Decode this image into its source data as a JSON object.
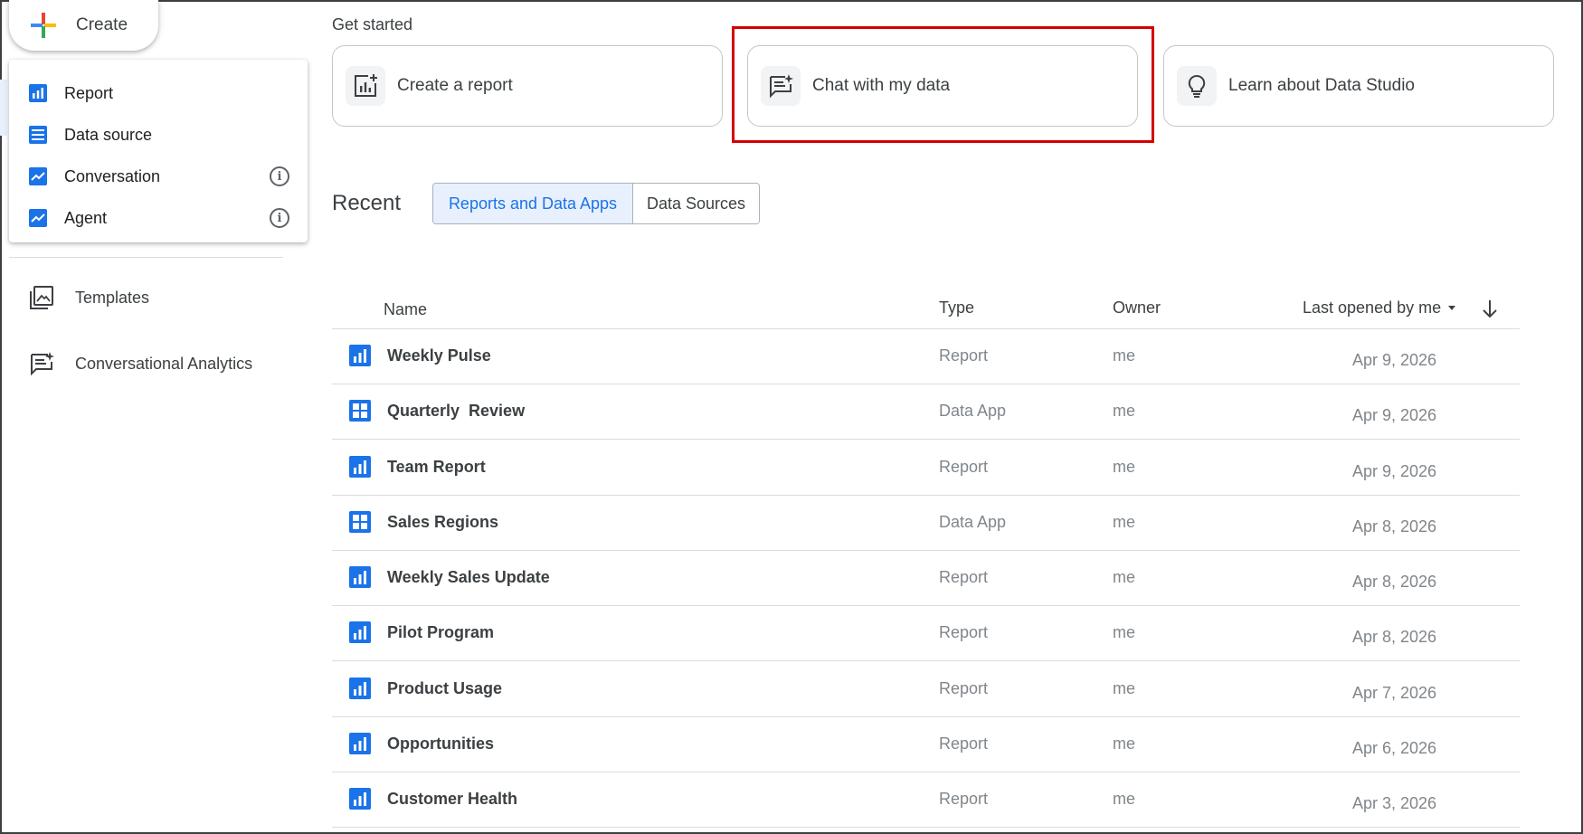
{
  "create": {
    "label": "Create"
  },
  "create_menu": {
    "items": [
      {
        "label": "Report",
        "icon": "report-icon"
      },
      {
        "label": "Data source",
        "icon": "data-source-icon"
      },
      {
        "label": "Conversation",
        "icon": "conversation-icon",
        "info": true
      },
      {
        "label": "Agent",
        "icon": "agent-icon",
        "info": true
      }
    ]
  },
  "sidebar": {
    "items": [
      {
        "label": "Templates",
        "icon": "templates-icon"
      },
      {
        "label": "Conversational Analytics",
        "icon": "conversational-analytics-icon"
      }
    ]
  },
  "get_started": {
    "title": "Get started",
    "cards": [
      {
        "label": "Create a report",
        "icon": "create-report-icon"
      },
      {
        "label": "Chat with my data",
        "icon": "chat-data-icon"
      },
      {
        "label": "Learn about Data Studio",
        "icon": "lightbulb-icon"
      }
    ]
  },
  "recent": {
    "title": "Recent",
    "tabs": [
      {
        "label": "Reports and Data Apps",
        "active": true
      },
      {
        "label": "Data Sources",
        "active": false
      }
    ],
    "columns": {
      "name": "Name",
      "type": "Type",
      "owner": "Owner",
      "last_opened": "Last opened by me"
    },
    "rows": [
      {
        "name": "Weekly Pulse",
        "type": "Report",
        "owner": "me",
        "date": "Apr 9, 2026",
        "icon": "report-icon"
      },
      {
        "name": "Quarterly  Review",
        "type": "Data App",
        "owner": "me",
        "date": "Apr 9, 2026",
        "icon": "data-app-icon"
      },
      {
        "name": "Team Report",
        "type": "Report",
        "owner": "me",
        "date": "Apr 9, 2026",
        "icon": "report-icon"
      },
      {
        "name": "Sales Regions",
        "type": "Data App",
        "owner": "me",
        "date": "Apr 8, 2026",
        "icon": "data-app-icon"
      },
      {
        "name": "Weekly Sales Update",
        "type": "Report",
        "owner": "me",
        "date": "Apr 8, 2026",
        "icon": "report-icon"
      },
      {
        "name": "Pilot Program",
        "type": "Report",
        "owner": "me",
        "date": "Apr 8, 2026",
        "icon": "report-icon"
      },
      {
        "name": "Product Usage",
        "type": "Report",
        "owner": "me",
        "date": "Apr 7, 2026",
        "icon": "report-icon"
      },
      {
        "name": "Opportunities",
        "type": "Report",
        "owner": "me",
        "date": "Apr 6, 2026",
        "icon": "report-icon"
      },
      {
        "name": "Customer Health",
        "type": "Report",
        "owner": "me",
        "date": "Apr 3, 2026",
        "icon": "report-icon"
      }
    ]
  },
  "colors": {
    "accent": "#1a73e8",
    "highlight": "#d50000",
    "icon_blue": "#1a73e8"
  }
}
